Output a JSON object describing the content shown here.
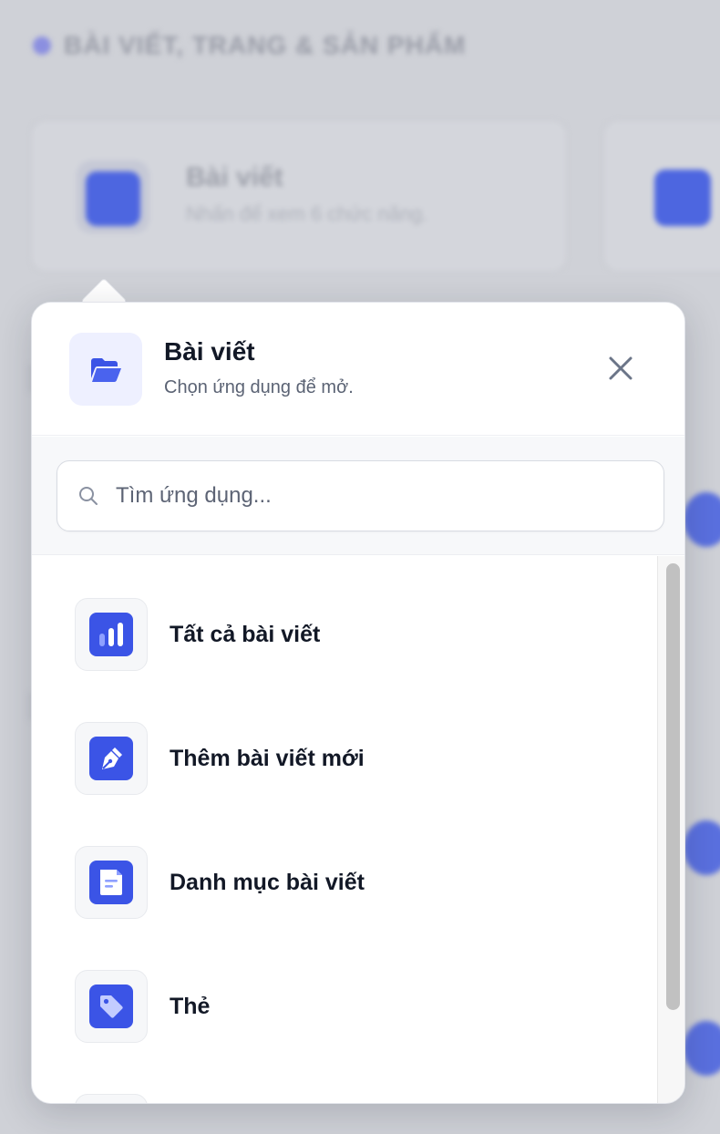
{
  "background": {
    "section_title": "BÀI VIẾT, TRANG & SẢN PHẨM",
    "card_title": "Bài viết",
    "card_subtitle": "Nhấn để xem 6 chức năng."
  },
  "popover": {
    "title": "Bài viết",
    "subtitle": "Chọn ứng dụng để mở.",
    "header_icon": "folder-open-icon",
    "close_icon": "close-icon",
    "search": {
      "placeholder": "Tìm ứng dụng...",
      "value": ""
    },
    "items": [
      {
        "label": "Tất cả bài viết",
        "icon": "bar-chart-icon"
      },
      {
        "label": "Thêm bài viết mới",
        "icon": "pen-nib-icon"
      },
      {
        "label": "Danh mục bài viết",
        "icon": "document-icon"
      },
      {
        "label": "Thẻ",
        "icon": "tag-icon"
      }
    ]
  },
  "colors": {
    "accent": "#3b54e6",
    "header_icon_bg": "#eef0ff",
    "text_primary": "#121826",
    "text_secondary": "#5b6374"
  }
}
